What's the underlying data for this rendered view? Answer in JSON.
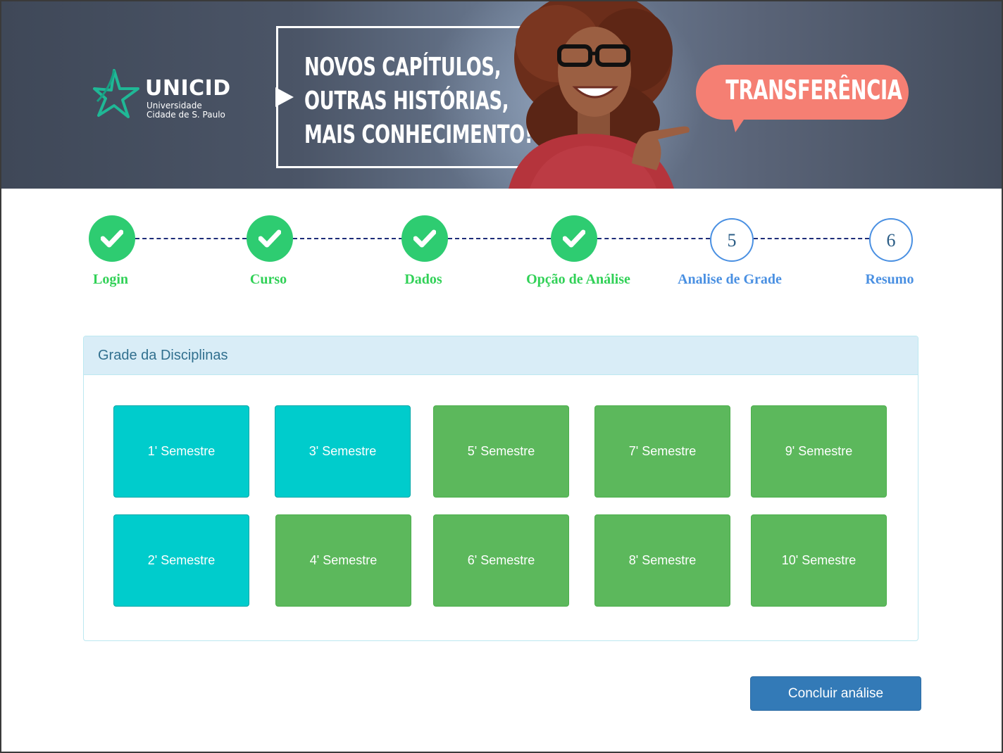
{
  "banner": {
    "logo_name": "UNICID",
    "logo_sub_line1": "Universidade",
    "logo_sub_line2": "Cidade de S. Paulo",
    "headline_line1": "NOVOS CAPÍTULOS,",
    "headline_line2": "OUTRAS HISTÓRIAS,",
    "headline_line3": "MAIS CONHECIMENTO!",
    "bubble_text": "TRANSFERÊNCIA",
    "colors": {
      "bubble": "#f57f73",
      "logo_star": "#1fb896"
    }
  },
  "stepper": {
    "steps": [
      {
        "label": "Login",
        "status": "done",
        "icon": "check-icon"
      },
      {
        "label": "Curso",
        "status": "done",
        "icon": "check-icon"
      },
      {
        "label": "Dados",
        "status": "done",
        "icon": "check-icon"
      },
      {
        "label": "Opção de Análise",
        "status": "done",
        "icon": "check-icon"
      },
      {
        "label": "Analise de Grade",
        "status": "current",
        "number": "5"
      },
      {
        "label": "Resumo",
        "status": "pending",
        "number": "6"
      }
    ],
    "colors": {
      "done": "#2ecc71",
      "pending": "#4a90e2",
      "line": "#1e2d78"
    }
  },
  "panel": {
    "title": "Grade da Disciplinas",
    "semesters": [
      {
        "label": "1' Semestre",
        "color": "cyan"
      },
      {
        "label": "2' Semestre",
        "color": "cyan"
      },
      {
        "label": "3' Semestre",
        "color": "cyan"
      },
      {
        "label": "4' Semestre",
        "color": "green"
      },
      {
        "label": "5' Semestre",
        "color": "green"
      },
      {
        "label": "6' Semestre",
        "color": "green"
      },
      {
        "label": "7' Semestre",
        "color": "green"
      },
      {
        "label": "8' Semestre",
        "color": "green"
      },
      {
        "label": "9' Semestre",
        "color": "green"
      },
      {
        "label": "10' Semestre",
        "color": "green"
      }
    ]
  },
  "actions": {
    "conclude_label": "Concluir análise"
  }
}
